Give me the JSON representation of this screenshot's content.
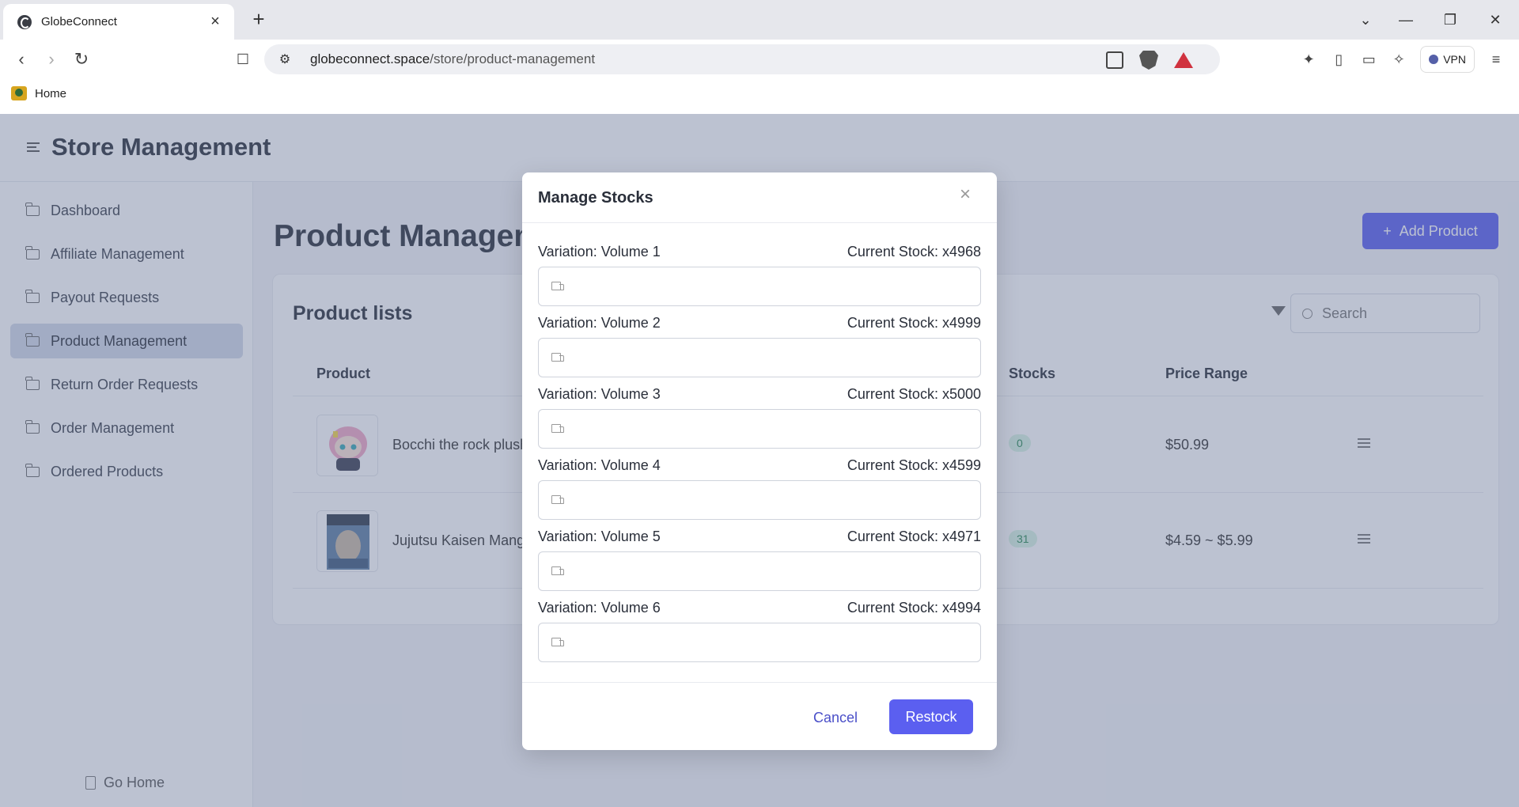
{
  "browser": {
    "tab_title": "GlobeConnect",
    "url_host": "globeconnect.space",
    "url_path": "/store/product-management",
    "bookmark_home": "Home",
    "vpn_label": "VPN"
  },
  "app": {
    "title": "Store Management",
    "sidebar": {
      "items": [
        {
          "label": "Dashboard"
        },
        {
          "label": "Affiliate Management"
        },
        {
          "label": "Payout Requests"
        },
        {
          "label": "Product Management",
          "active": true
        },
        {
          "label": "Return Order Requests"
        },
        {
          "label": "Order Management"
        },
        {
          "label": "Ordered Products"
        }
      ],
      "go_home": "Go Home"
    },
    "main": {
      "page_title": "Product Management",
      "add_product": "Add Product",
      "card_title": "Product lists",
      "search_placeholder": "Search",
      "columns": {
        "product": "Product",
        "stocks": "Stocks",
        "price_range": "Price Range"
      },
      "rows": [
        {
          "name": "Bocchi the rock plush",
          "stock_badge": "0",
          "price": "$50.99"
        },
        {
          "name": "Jujutsu Kaisen Manga",
          "stock_badge": "31",
          "price": "$4.59 ~ $5.99"
        }
      ]
    }
  },
  "modal": {
    "title": "Manage Stocks",
    "variations": [
      {
        "label": "Variation: Volume 1",
        "stock": "Current Stock: x4968"
      },
      {
        "label": "Variation: Volume 2",
        "stock": "Current Stock: x4999"
      },
      {
        "label": "Variation: Volume 3",
        "stock": "Current Stock: x5000"
      },
      {
        "label": "Variation: Volume 4",
        "stock": "Current Stock: x4599"
      },
      {
        "label": "Variation: Volume 5",
        "stock": "Current Stock: x4971"
      },
      {
        "label": "Variation: Volume 6",
        "stock": "Current Stock: x4994"
      }
    ],
    "cancel": "Cancel",
    "restock": "Restock"
  },
  "colors": {
    "accent": "#5b5ff0",
    "overlay": "#5f6e91",
    "active_nav": "#d3d9e8"
  }
}
